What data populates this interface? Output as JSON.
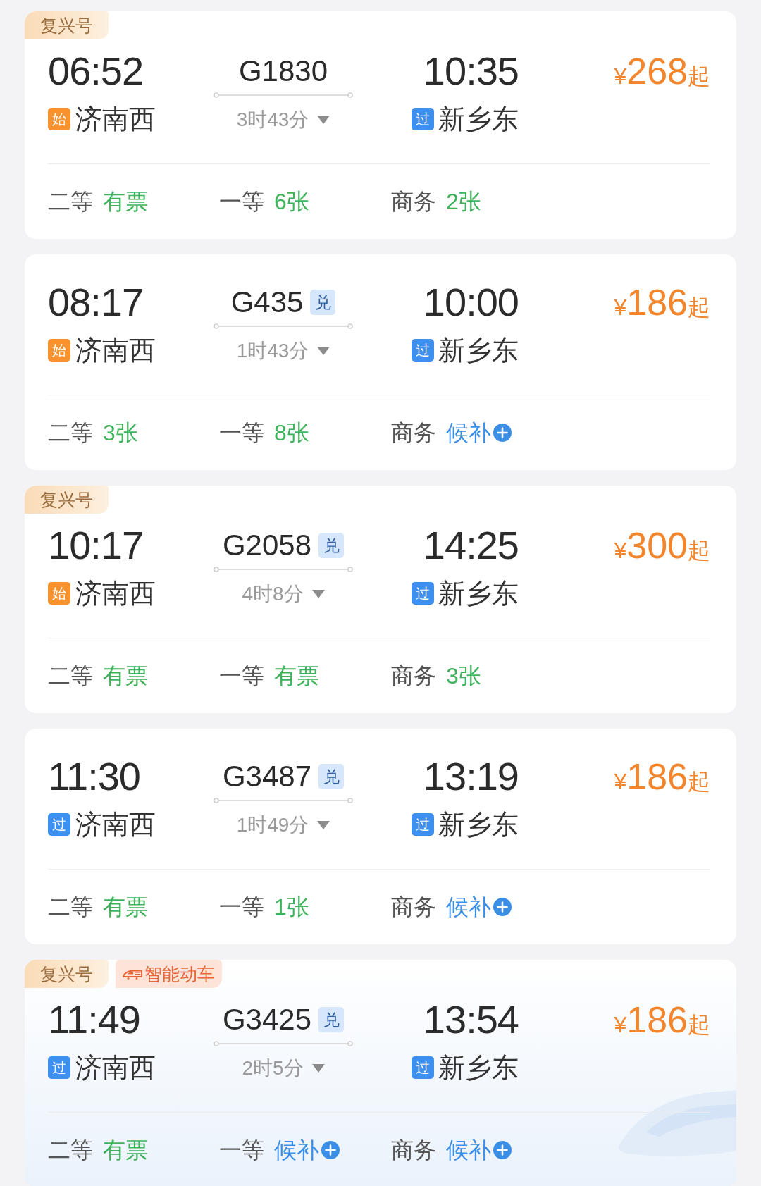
{
  "trains": [
    {
      "tags": [
        {
          "kind": "fuxing",
          "text": "复兴号"
        }
      ],
      "depart": {
        "time": "06:52",
        "station_tag": {
          "kind": "origin",
          "text": "始"
        },
        "station": "济南西"
      },
      "train_number": "G1830",
      "duration": "3时43分",
      "arrive": {
        "time": "10:35",
        "station_tag": {
          "kind": "pass",
          "text": "过"
        },
        "station": "新乡东"
      },
      "price": {
        "currency": "¥",
        "amount": "268",
        "suffix": "起"
      },
      "seats": [
        {
          "class": "二等",
          "availability": "有票",
          "kind": "available"
        },
        {
          "class": "一等",
          "availability": "6张",
          "kind": "available"
        },
        {
          "class": "商务",
          "availability": "2张",
          "kind": "available"
        }
      ]
    },
    {
      "depart": {
        "time": "08:17",
        "station_tag": {
          "kind": "origin",
          "text": "始"
        },
        "station": "济南西"
      },
      "train_number": "G435",
      "exchange_tag": "兑",
      "duration": "1时43分",
      "arrive": {
        "time": "10:00",
        "station_tag": {
          "kind": "pass",
          "text": "过"
        },
        "station": "新乡东"
      },
      "price": {
        "currency": "¥",
        "amount": "186",
        "suffix": "起"
      },
      "seats": [
        {
          "class": "二等",
          "availability": "3张",
          "kind": "available"
        },
        {
          "class": "一等",
          "availability": "8张",
          "kind": "available"
        },
        {
          "class": "商务",
          "availability": "候补",
          "kind": "waitlist"
        }
      ]
    },
    {
      "tags": [
        {
          "kind": "fuxing",
          "text": "复兴号"
        }
      ],
      "depart": {
        "time": "10:17",
        "station_tag": {
          "kind": "origin",
          "text": "始"
        },
        "station": "济南西"
      },
      "train_number": "G2058",
      "exchange_tag": "兑",
      "duration": "4时8分",
      "arrive": {
        "time": "14:25",
        "station_tag": {
          "kind": "pass",
          "text": "过"
        },
        "station": "新乡东"
      },
      "price": {
        "currency": "¥",
        "amount": "300",
        "suffix": "起"
      },
      "seats": [
        {
          "class": "二等",
          "availability": "有票",
          "kind": "available"
        },
        {
          "class": "一等",
          "availability": "有票",
          "kind": "available"
        },
        {
          "class": "商务",
          "availability": "3张",
          "kind": "available"
        }
      ]
    },
    {
      "depart": {
        "time": "11:30",
        "station_tag": {
          "kind": "pass",
          "text": "过"
        },
        "station": "济南西"
      },
      "train_number": "G3487",
      "exchange_tag": "兑",
      "duration": "1时49分",
      "arrive": {
        "time": "13:19",
        "station_tag": {
          "kind": "pass",
          "text": "过"
        },
        "station": "新乡东"
      },
      "price": {
        "currency": "¥",
        "amount": "186",
        "suffix": "起"
      },
      "seats": [
        {
          "class": "二等",
          "availability": "有票",
          "kind": "available"
        },
        {
          "class": "一等",
          "availability": "1张",
          "kind": "available"
        },
        {
          "class": "商务",
          "availability": "候补",
          "kind": "waitlist"
        }
      ]
    },
    {
      "tags": [
        {
          "kind": "fuxing",
          "text": "复兴号"
        },
        {
          "kind": "smart",
          "text": "智能动车"
        }
      ],
      "depart": {
        "time": "11:49",
        "station_tag": {
          "kind": "pass",
          "text": "过"
        },
        "station": "济南西"
      },
      "train_number": "G3425",
      "exchange_tag": "兑",
      "duration": "2时5分",
      "arrive": {
        "time": "13:54",
        "station_tag": {
          "kind": "pass",
          "text": "过"
        },
        "station": "新乡东"
      },
      "price": {
        "currency": "¥",
        "amount": "186",
        "suffix": "起"
      },
      "seats": [
        {
          "class": "二等",
          "availability": "有票",
          "kind": "available"
        },
        {
          "class": "一等",
          "availability": "候补",
          "kind": "waitlist"
        },
        {
          "class": "商务",
          "availability": "候补",
          "kind": "waitlist"
        }
      ]
    }
  ]
}
